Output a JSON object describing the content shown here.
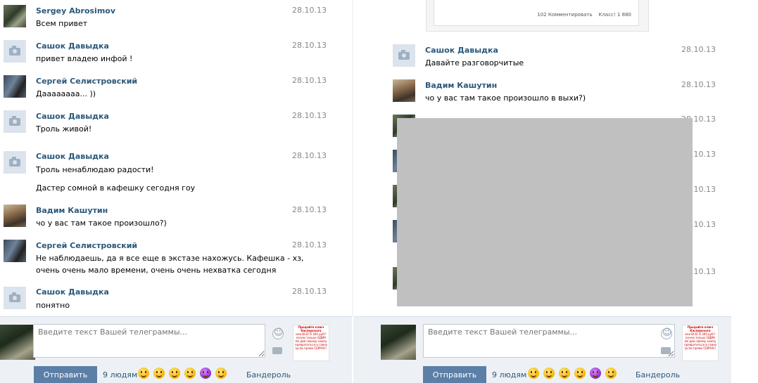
{
  "left": {
    "messages": [
      {
        "name": "Sergey Abrosimov",
        "date": "28.10.13",
        "lines": [
          "Всем привет"
        ]
      },
      {
        "name": "Сашок Давыдка",
        "date": "28.10.13",
        "lines": [
          "привет владею инфой !"
        ]
      },
      {
        "name": "Сергей Селистровский",
        "date": "28.10.13",
        "lines": [
          "Даааааааа... ))"
        ]
      },
      {
        "name": "Сашок Давыдка",
        "date": "28.10.13",
        "lines": [
          "Троль живой!"
        ]
      },
      {
        "name": "Сашок Давыдка",
        "date": "28.10.13",
        "lines": [
          "Троль ненаблюдаю радости!",
          "Дастер сомной в кафешку сегодня гоу"
        ]
      },
      {
        "name": "Вадим Кашутин",
        "date": "28.10.13",
        "lines": [
          "чо у вас там такое произошло?)"
        ]
      },
      {
        "name": "Сергей Селистровский",
        "date": "28.10.13",
        "lines": [
          "Не наблюдаешь, да я все еще в экстазе нахожусь. Кафешка - хз,",
          "очень очень мало времени, очень очень нехватка сегодня"
        ]
      },
      {
        "name": "Сашок Давыдка",
        "date": "28.10.13",
        "lines": [
          "понятно"
        ]
      }
    ],
    "composer": {
      "placeholder": "Введите текст Вашей телеграммы...",
      "send_label": "Отправить",
      "recipients": "9 людям",
      "parcel_label": "Бандероль",
      "emoji_icons": [
        "grin-icon",
        "laugh-icon",
        "smile-icon",
        "unamused-icon",
        "devil-icon",
        "surprised-icon"
      ]
    }
  },
  "right": {
    "shared_post": {
      "comments": "102 Комментировать",
      "likes": "Класс! 1 880"
    },
    "messages": [
      {
        "name": "Сашок Давыдка",
        "date": "28.10.13",
        "lines": [
          "Давайте разговорчитые"
        ]
      },
      {
        "name": "Вадим Кашутин",
        "date": "28.10.13",
        "lines": [
          "чо у вас там такое произошло в выхи?)"
        ]
      }
    ],
    "partial_dates": [
      "28.10.13",
      "28.10.13",
      "28.10.13",
      "28.10.13",
      "28.10.13"
    ],
    "composer": {
      "placeholder": "Введите текст Вашей телеграммы...",
      "send_label": "Отправить",
      "recipients": "9 людям",
      "parcel_label": "Бандероль"
    }
  },
  "ad": {
    "lines": [
      "Продайте ключ Касперского",
      "или ВСЕГО 300 руб!!",
      "почем только ОДИН",
      "Не дай своему компу",
      "превратиться в гавно",
      "(успи прямо СЕЙЧАС!"
    ]
  },
  "colors": {
    "link": "#2b587a",
    "date": "#888888",
    "send_button": "#5b7fa6",
    "composer_bg": "#edf1f5"
  }
}
